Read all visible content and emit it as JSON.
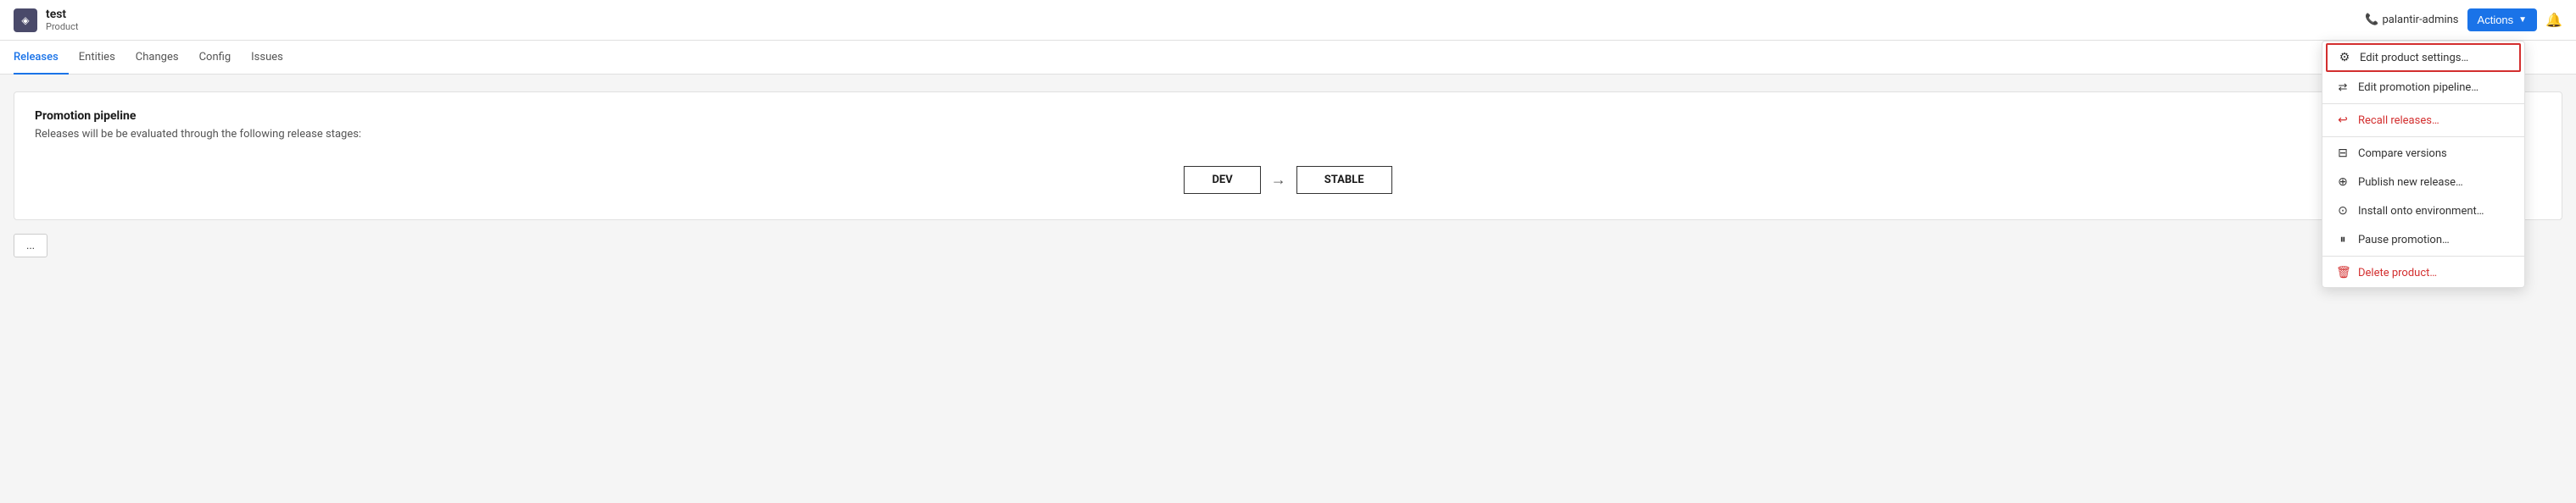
{
  "header": {
    "app_icon": "◈",
    "product_name": "test",
    "product_type": "Product",
    "palantir_admins_label": "palantir-admins",
    "actions_label": "Actions",
    "actions_caret": "▼",
    "bell": "🔔"
  },
  "nav": {
    "tabs": [
      {
        "id": "releases",
        "label": "Releases",
        "active": true
      },
      {
        "id": "entities",
        "label": "Entities",
        "active": false
      },
      {
        "id": "changes",
        "label": "Changes",
        "active": false
      },
      {
        "id": "config",
        "label": "Config",
        "active": false
      },
      {
        "id": "issues",
        "label": "Issues",
        "active": false
      }
    ]
  },
  "main": {
    "card": {
      "title": "Promotion pipeline",
      "subtitle": "Releases will be be evaluated through the following release stages:",
      "stages": [
        "DEV",
        "STABLE"
      ]
    },
    "small_button_label": "..."
  },
  "dropdown": {
    "items": [
      {
        "id": "edit-product-settings",
        "label": "Edit product settings…",
        "icon": "⚙",
        "icon_color": "default",
        "highlighted": true,
        "red": false
      },
      {
        "id": "edit-promotion-pipeline",
        "label": "Edit promotion pipeline…",
        "icon": "⇄",
        "icon_color": "default",
        "highlighted": false,
        "red": false
      },
      {
        "id": "recall-releases",
        "label": "Recall releases…",
        "icon": "↩",
        "icon_color": "red",
        "highlighted": false,
        "red": true
      },
      {
        "id": "compare-versions",
        "label": "Compare versions",
        "icon": "⊟",
        "icon_color": "default",
        "highlighted": false,
        "red": false
      },
      {
        "id": "publish-new-release",
        "label": "Publish new release…",
        "icon": "⊕",
        "icon_color": "default",
        "highlighted": false,
        "red": false
      },
      {
        "id": "install-onto-environment",
        "label": "Install onto environment…",
        "icon": "⊙",
        "icon_color": "default",
        "highlighted": false,
        "red": false
      },
      {
        "id": "pause-promotion",
        "label": "Pause promotion…",
        "icon": "⏸",
        "icon_color": "default",
        "highlighted": false,
        "red": false
      },
      {
        "id": "delete-product",
        "label": "Delete product…",
        "icon": "🗑",
        "icon_color": "red",
        "highlighted": false,
        "red": true
      }
    ]
  }
}
